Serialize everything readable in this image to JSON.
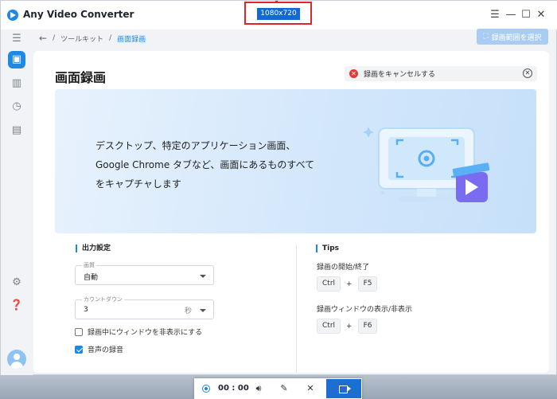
{
  "window": {
    "title": "Any Video Converter"
  },
  "resolution_badge": "1080x720",
  "sidebar": {
    "icons": [
      "menu-icon",
      "toolbox-icon",
      "map-icon",
      "clock-icon",
      "bookmark-icon",
      "gear-icon",
      "help-icon",
      "avatar-icon"
    ]
  },
  "breadcrumb": {
    "toolkit": "ツールキット",
    "current": "画面録画"
  },
  "select_region_button": "録画範囲を選択",
  "page_title": "画面録画",
  "cancel_bar": {
    "text": "録画をキャンセルする"
  },
  "banner": {
    "text": "デスクトップ、特定のアプリケーション画面、Google Chrome タブなど、画面にあるものすべてをキャプチャします"
  },
  "output_settings": {
    "title": "出力設定",
    "quality": {
      "label": "画質",
      "value": "自動"
    },
    "countdown": {
      "label": "カウントダウン",
      "value": "3",
      "unit": "秒"
    },
    "hide_window": {
      "label": "録画中にウィンドウを非表示にする",
      "checked": false
    },
    "record_audio": {
      "label": "音声の録音",
      "checked": true
    }
  },
  "tips": {
    "title": "Tips",
    "items": [
      {
        "label": "録画の開始/終了",
        "keys": [
          "Ctrl",
          "F5"
        ]
      },
      {
        "label": "録画ウィンドウの表示/非表示",
        "keys": [
          "Ctrl",
          "F6"
        ]
      }
    ],
    "plus": "+"
  },
  "rec_toolbar": {
    "time": "00 : 00"
  },
  "colors": {
    "accent": "#1e88e5",
    "danger": "#e53935",
    "record_button": "#1c6fd2"
  }
}
